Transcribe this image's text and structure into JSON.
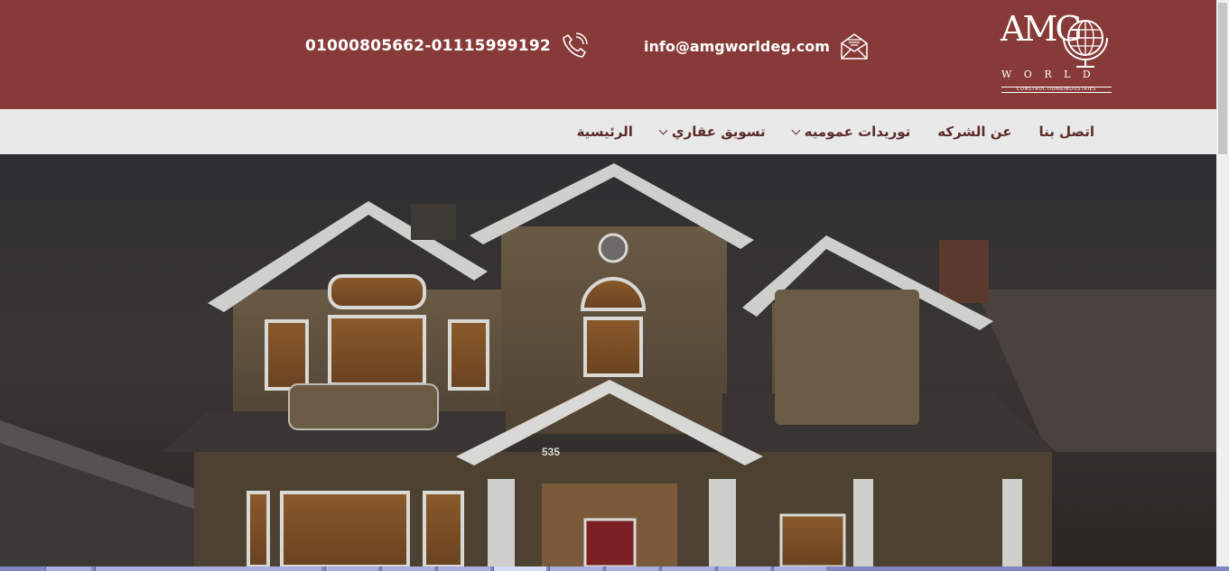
{
  "header": {
    "phone": "01000805662-01115999192",
    "phone_icon": "phone-icon",
    "email": "info@amgworldeg.com",
    "email_icon": "envelope-icon",
    "logo": {
      "mark": "AMG",
      "word": "WORLD",
      "tagline": "CONSTRUCTION&INDUSTRIES"
    }
  },
  "nav": {
    "items": [
      {
        "label": "الرئيسية",
        "dropdown": false
      },
      {
        "label": "تسويق عقاري",
        "dropdown": true
      },
      {
        "label": "توريدات عموميه",
        "dropdown": true
      },
      {
        "label": "عن الشركه",
        "dropdown": false
      },
      {
        "label": "اتصل بنا",
        "dropdown": false
      }
    ]
  },
  "hero": {
    "house_number": "535"
  },
  "colors": {
    "header_bg": "#873a38",
    "nav_bg": "#e9e9e9",
    "nav_text": "#5b2b29"
  }
}
